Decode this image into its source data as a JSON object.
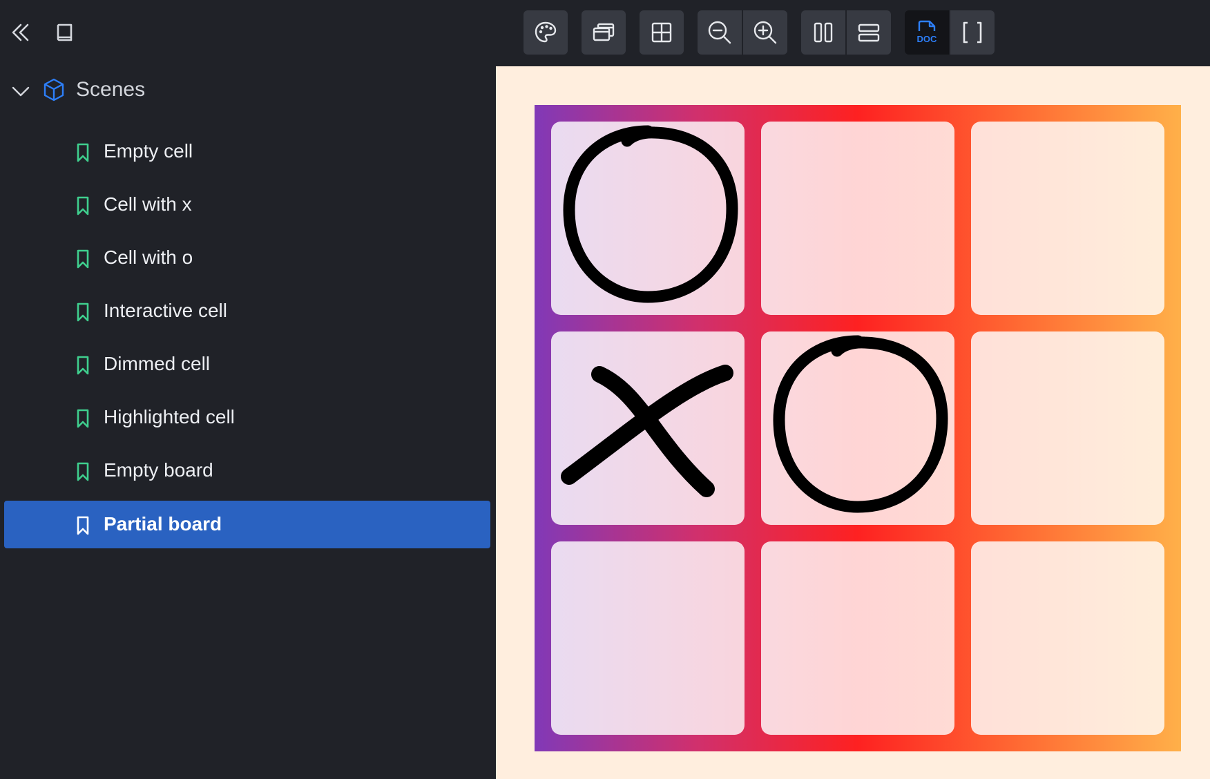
{
  "toolbar": {
    "collapse_icon": "double-chevron-left-icon",
    "book_icon": "book-icon",
    "tools": [
      {
        "name": "palette-icon"
      },
      {
        "name": "windows-icon"
      },
      {
        "name": "grid-icon"
      },
      {
        "name": "zoom-out-icon"
      },
      {
        "name": "zoom-in-icon"
      },
      {
        "name": "columns-icon"
      },
      {
        "name": "rows-icon"
      },
      {
        "name": "doc-icon",
        "label": "DOC",
        "active": true
      },
      {
        "name": "brackets-icon"
      }
    ]
  },
  "sidebar": {
    "group_label": "Scenes",
    "stories": [
      {
        "label": "Empty cell"
      },
      {
        "label": "Cell with x"
      },
      {
        "label": "Cell with o"
      },
      {
        "label": "Interactive cell"
      },
      {
        "label": "Dimmed cell"
      },
      {
        "label": "Highlighted cell"
      },
      {
        "label": "Empty board"
      },
      {
        "label": "Partial board",
        "selected": true
      }
    ]
  },
  "board": {
    "cells": [
      "o",
      "",
      "",
      "x",
      "o",
      "",
      "",
      "",
      ""
    ]
  },
  "colors": {
    "accent": "#2a62c1",
    "story_icon": "#3fcf8e",
    "scene_icon": "#2d7ff9",
    "canvas_bg": "#ffeede"
  }
}
